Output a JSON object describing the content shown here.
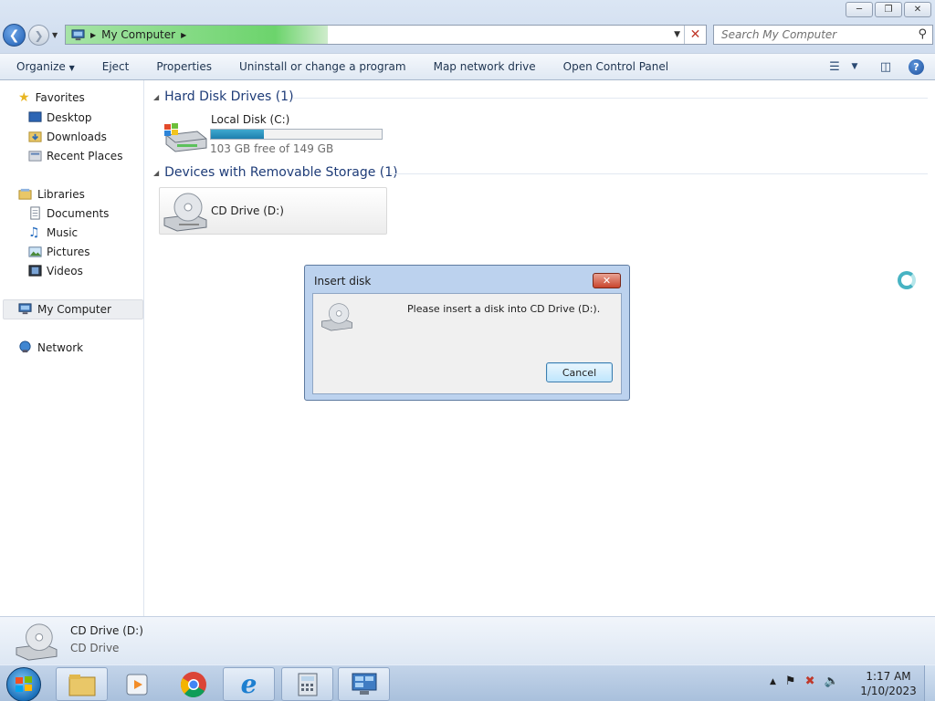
{
  "window": {
    "address": {
      "location": "My Computer"
    },
    "search": {
      "placeholder": "Search My Computer"
    }
  },
  "commandbar": {
    "items": [
      "Organize",
      "Eject",
      "Properties",
      "Uninstall or change a program",
      "Map network drive",
      "Open Control Panel"
    ]
  },
  "sidebar": {
    "favorites": {
      "label": "Favorites",
      "items": [
        "Desktop",
        "Downloads",
        "Recent Places"
      ]
    },
    "libraries": {
      "label": "Libraries",
      "items": [
        "Documents",
        "Music",
        "Pictures",
        "Videos"
      ]
    },
    "computer": {
      "label": "My Computer"
    },
    "network": {
      "label": "Network"
    }
  },
  "content": {
    "hdd_group": {
      "title": "Hard Disk Drives (1)"
    },
    "local_disk": {
      "name": "Local Disk (C:)",
      "free_text": "103 GB free of 149 GB",
      "used_fraction": 0.31
    },
    "removable_group": {
      "title": "Devices with Removable Storage (1)"
    },
    "cd_drive": {
      "name": "CD Drive (D:)"
    }
  },
  "dialog": {
    "title": "Insert disk",
    "message": "Please insert a disk into CD Drive (D:).",
    "cancel_label": "Cancel"
  },
  "details": {
    "name": "CD Drive (D:)",
    "type": "CD Drive"
  },
  "taskbar": {
    "time": "1:17 AM",
    "date": "1/10/2023"
  },
  "colors": {
    "accent": "#1e3c78",
    "progress": "#2a94c2"
  }
}
